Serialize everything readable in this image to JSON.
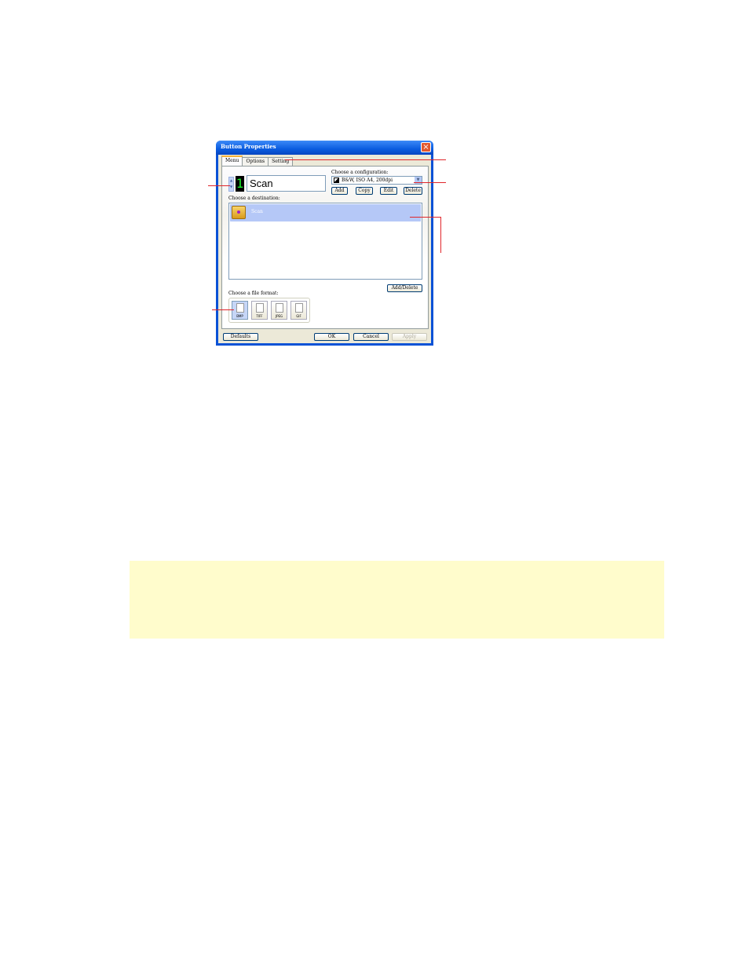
{
  "dialog": {
    "title": "Button Properties",
    "close_icon": "×",
    "tabs": [
      {
        "label": "Menu",
        "active": true
      },
      {
        "label": "Options",
        "active": false
      },
      {
        "label": "Setting",
        "active": false
      }
    ],
    "button_number": "1",
    "button_name": "Scan",
    "spin_up": "▲",
    "spin_down": "▼",
    "configuration": {
      "label": "Choose a configuration:",
      "selected": "B&W, ISO A4, 200dpi",
      "arrow": "▼",
      "buttons": [
        "Add",
        "Copy",
        "Edit",
        "Delete"
      ]
    },
    "destination": {
      "label": "Choose a destination:",
      "items": [
        {
          "label": "Scan",
          "selected": true
        }
      ],
      "add_delete_label": "Add/Delete"
    },
    "file_format": {
      "label": "Choose a file format:",
      "formats": [
        {
          "label": "BMP",
          "selected": true
        },
        {
          "label": "TIFF",
          "selected": false
        },
        {
          "label": "JPEG",
          "selected": false
        },
        {
          "label": "GIF",
          "selected": false
        }
      ]
    },
    "footer": {
      "defaults_label": "Defaults",
      "ok_label": "OK",
      "cancel_label": "Cancel",
      "apply_label": "Apply"
    }
  },
  "colors": {
    "callout_line": "#e0262b",
    "note_background": "#fffccc",
    "selection": "#b5c8f7",
    "title_bar": "#0a5ce0"
  }
}
